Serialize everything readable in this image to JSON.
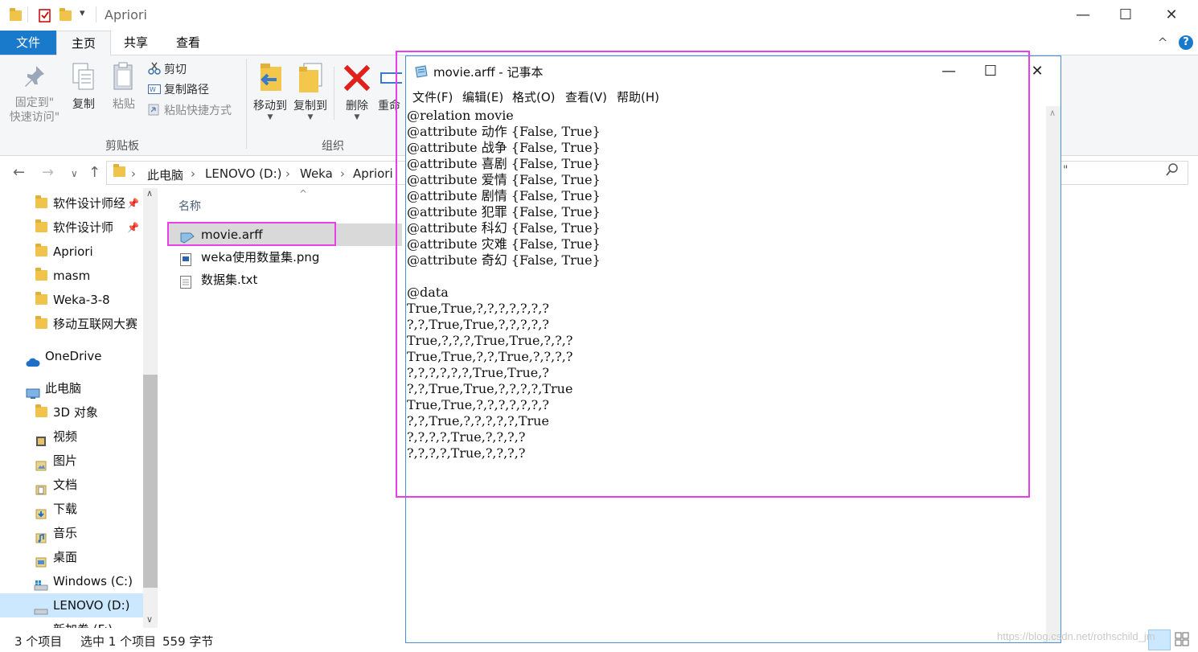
{
  "explorer": {
    "title": "Apriori",
    "quick_access_arrow": "▾",
    "window_controls": {
      "minimize": "—",
      "maximize": "☐",
      "close": "✕"
    },
    "ribbon_tabs": {
      "file": "文件",
      "home": "主页",
      "share": "共享",
      "view": "查看"
    },
    "ribbon_collapse": "^",
    "help": "?",
    "clipboard": {
      "pin_label_1": "固定到\"",
      "pin_label_2": "快速访问\"",
      "copy": "复制",
      "paste": "粘贴",
      "cut": "剪切",
      "copy_path": "复制路径",
      "paste_shortcut": "粘贴快捷方式",
      "group_label": "剪贴板"
    },
    "organize": {
      "move_to": "移动到",
      "copy_to": "复制到",
      "delete": "删除",
      "rename": "重命",
      "group_label": "组织"
    },
    "address": {
      "crumbs": [
        "此电脑",
        "LENOVO (D:)",
        "Weka",
        "Apriori"
      ],
      "search_fragment": "\""
    },
    "nav": {
      "quick_access": [
        {
          "label": "软件设计师经",
          "pinned": true
        },
        {
          "label": "软件设计师",
          "pinned": true
        },
        {
          "label": "Apriori",
          "pinned": false
        },
        {
          "label": "masm",
          "pinned": false
        },
        {
          "label": "Weka-3-8",
          "pinned": false
        },
        {
          "label": "移动互联网大赛",
          "pinned": false
        }
      ],
      "onedrive": "OneDrive",
      "this_pc": "此电脑",
      "pc_items": [
        "3D 对象",
        "视频",
        "图片",
        "文档",
        "下载",
        "音乐",
        "桌面",
        "Windows (C:)",
        "LENOVO (D:)",
        "新加卷 (F:)"
      ],
      "selected": "LENOVO (D:)"
    },
    "filelist": {
      "column_name": "名称",
      "files": [
        {
          "name": "movie.arff",
          "type": "arff",
          "selected": true
        },
        {
          "name": "weka使用数量集.png",
          "type": "png",
          "selected": false
        },
        {
          "name": "数据集.txt",
          "type": "txt",
          "selected": false
        }
      ]
    },
    "status": {
      "item_count": "3 个项目",
      "selection": "选中 1 个项目",
      "size": "559 字节"
    },
    "watermark": "https://blog.csdn.net/rothschild_jm"
  },
  "notepad": {
    "title": "movie.arff - 记事本",
    "window_controls": {
      "minimize": "—",
      "maximize": "☐",
      "close": "✕"
    },
    "menu": [
      "文件(F)",
      "编辑(E)",
      "格式(O)",
      "查看(V)",
      "帮助(H)"
    ],
    "content": "@relation movie\n@attribute 动作 {False, True}\n@attribute 战争 {False, True}\n@attribute 喜剧 {False, True}\n@attribute 爱情 {False, True}\n@attribute 剧情 {False, True}\n@attribute 犯罪 {False, True}\n@attribute 科幻 {False, True}\n@attribute 灾难 {False, True}\n@attribute 奇幻 {False, True}\n\n@data\nTrue,True,?,?,?,?,?,?,?\n?,?,True,True,?,?,?,?,?\nTrue,?,?,?,True,True,?,?,?\nTrue,True,?,?,True,?,?,?,?\n?,?,?,?,?,?,True,True,?\n?,?,True,True,?,?,?,?,True\nTrue,True,?,?,?,?,?,?,?\n?,?,True,?,?,?,?,?,True\n?,?,?,?,True,?,?,?,?\n?,?,?,?,True,?,?,?,?"
  },
  "colors": {
    "accent": "#1979ca",
    "highlight_box": "#e83fe8",
    "selection": "#cce8ff"
  }
}
